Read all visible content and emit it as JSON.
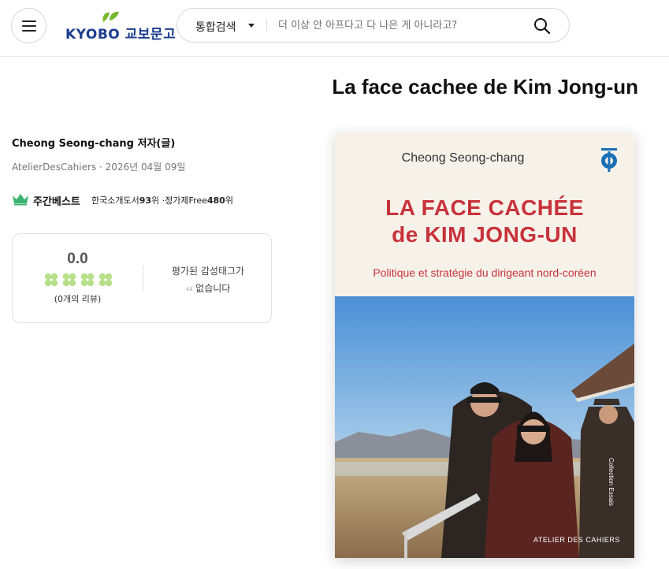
{
  "header": {
    "logo": {
      "text": "KYOBO 교보문고",
      "brand_color": "#1a3d8f",
      "leaf_color": "#77b82a"
    },
    "search": {
      "category": "통합검색",
      "placeholder": "더 이상 안 아프다고 다 나은 게 아니라고?"
    }
  },
  "book": {
    "title": "La face cachee de Kim Jong-un",
    "author": "Cheong Seong-chang 저자(글)",
    "publisher_date": "AtelierDesCahiers · 2026년 04월 09일"
  },
  "bestseller": {
    "label": "주간베스트",
    "category_prefix": "한국소개도서",
    "category_rank": "93",
    "rank_unit": "위",
    "free_prefix": " ·정가제Free",
    "free_rank": "480",
    "free_unit": "위"
  },
  "review": {
    "score": "0.0",
    "count_text": "(0개의 리뷰)",
    "emotion_line1": "평가된 감성태그가",
    "emotion_line2": "없습니다",
    "clover_color": "#b7e08a"
  },
  "cover": {
    "author": "Cheong Seong-chang",
    "title_line1": "LA FACE CACHÉE",
    "title_line2": "de KIM JONG-UN",
    "subtitle": "Politique et stratégie du dirigeant nord-coréen",
    "series": "Collection Essais",
    "publisher": "ATELIER DES CAHIERS",
    "title_color": "#c8323a"
  }
}
